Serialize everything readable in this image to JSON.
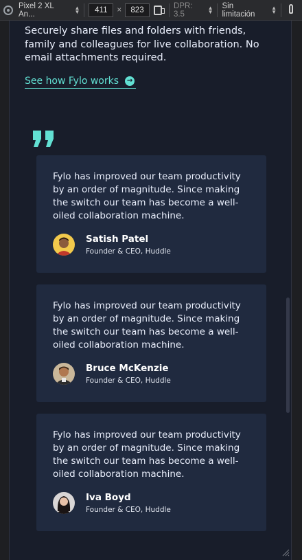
{
  "devtools": {
    "device": "Pixel 2 XL An...",
    "width": "411",
    "times": "×",
    "height": "823",
    "dpr": "DPR: 3.5",
    "throttle": "Sin limitación"
  },
  "intro": {
    "text": "Securely share files and folders with friends, family and colleagues for live collaboration. No email attachments required.",
    "link_label": "See how Fylo works"
  },
  "colors": {
    "accent": "#62e0d3",
    "background": "#181d2a",
    "card": "#202a3f"
  },
  "testimonials": [
    {
      "quote": "Fylo has improved our team productivity by an order of magnitude. Since making the switch our team has become a well-oiled collaboration machine.",
      "name": "Satish Patel",
      "role": "Founder & CEO, Huddle"
    },
    {
      "quote": "Fylo has improved our team productivity by an order of magnitude. Since making the switch our team has become a well-oiled collaboration machine.",
      "name": "Bruce McKenzie",
      "role": "Founder & CEO, Huddle"
    },
    {
      "quote": "Fylo has improved our team productivity by an order of magnitude. Since making the switch our team has become a well-oiled collaboration machine.",
      "name": "Iva Boyd",
      "role": "Founder & CEO, Huddle"
    }
  ]
}
